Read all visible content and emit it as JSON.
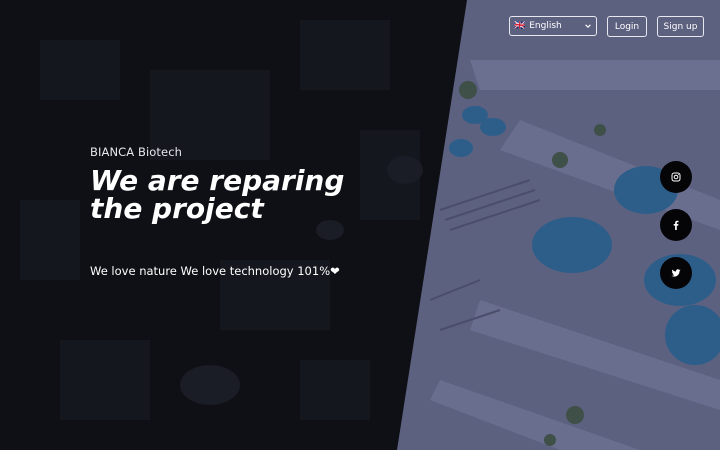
{
  "header": {
    "language_select": {
      "flag": "🇬🇧",
      "value": "English"
    },
    "login_label": "Login",
    "signup_label": "Sign up"
  },
  "hero": {
    "brand": "BIANCA Biotech",
    "headline": "We are reparing the project",
    "tagline": "We love nature We love technology 101%❤"
  },
  "social": [
    {
      "name": "instagram",
      "icon": "instagram-icon"
    },
    {
      "name": "facebook",
      "icon": "facebook-icon"
    },
    {
      "name": "twitter",
      "icon": "twitter-icon"
    }
  ],
  "colors": {
    "dark_panel": "#0f1015",
    "illustration_ground": "#5d6180",
    "tank": "#2d5e8a",
    "social_bg": "#050508"
  }
}
